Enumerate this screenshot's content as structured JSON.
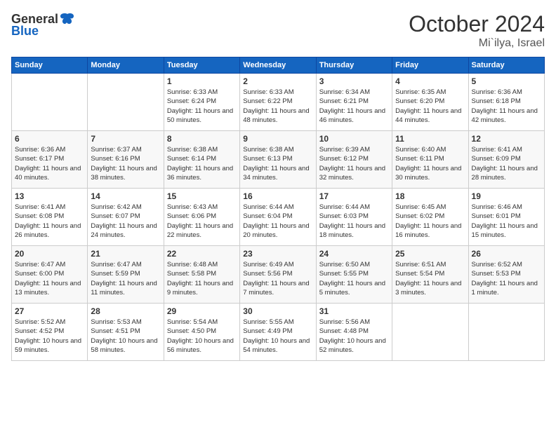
{
  "logo": {
    "general": "General",
    "blue": "Blue"
  },
  "title": "October 2024",
  "location": "Mi`ilya, Israel",
  "days_header": [
    "Sunday",
    "Monday",
    "Tuesday",
    "Wednesday",
    "Thursday",
    "Friday",
    "Saturday"
  ],
  "weeks": [
    [
      {
        "day": "",
        "info": ""
      },
      {
        "day": "",
        "info": ""
      },
      {
        "day": "1",
        "info": "Sunrise: 6:33 AM\nSunset: 6:24 PM\nDaylight: 11 hours and 50 minutes."
      },
      {
        "day": "2",
        "info": "Sunrise: 6:33 AM\nSunset: 6:22 PM\nDaylight: 11 hours and 48 minutes."
      },
      {
        "day": "3",
        "info": "Sunrise: 6:34 AM\nSunset: 6:21 PM\nDaylight: 11 hours and 46 minutes."
      },
      {
        "day": "4",
        "info": "Sunrise: 6:35 AM\nSunset: 6:20 PM\nDaylight: 11 hours and 44 minutes."
      },
      {
        "day": "5",
        "info": "Sunrise: 6:36 AM\nSunset: 6:18 PM\nDaylight: 11 hours and 42 minutes."
      }
    ],
    [
      {
        "day": "6",
        "info": "Sunrise: 6:36 AM\nSunset: 6:17 PM\nDaylight: 11 hours and 40 minutes."
      },
      {
        "day": "7",
        "info": "Sunrise: 6:37 AM\nSunset: 6:16 PM\nDaylight: 11 hours and 38 minutes."
      },
      {
        "day": "8",
        "info": "Sunrise: 6:38 AM\nSunset: 6:14 PM\nDaylight: 11 hours and 36 minutes."
      },
      {
        "day": "9",
        "info": "Sunrise: 6:38 AM\nSunset: 6:13 PM\nDaylight: 11 hours and 34 minutes."
      },
      {
        "day": "10",
        "info": "Sunrise: 6:39 AM\nSunset: 6:12 PM\nDaylight: 11 hours and 32 minutes."
      },
      {
        "day": "11",
        "info": "Sunrise: 6:40 AM\nSunset: 6:11 PM\nDaylight: 11 hours and 30 minutes."
      },
      {
        "day": "12",
        "info": "Sunrise: 6:41 AM\nSunset: 6:09 PM\nDaylight: 11 hours and 28 minutes."
      }
    ],
    [
      {
        "day": "13",
        "info": "Sunrise: 6:41 AM\nSunset: 6:08 PM\nDaylight: 11 hours and 26 minutes."
      },
      {
        "day": "14",
        "info": "Sunrise: 6:42 AM\nSunset: 6:07 PM\nDaylight: 11 hours and 24 minutes."
      },
      {
        "day": "15",
        "info": "Sunrise: 6:43 AM\nSunset: 6:06 PM\nDaylight: 11 hours and 22 minutes."
      },
      {
        "day": "16",
        "info": "Sunrise: 6:44 AM\nSunset: 6:04 PM\nDaylight: 11 hours and 20 minutes."
      },
      {
        "day": "17",
        "info": "Sunrise: 6:44 AM\nSunset: 6:03 PM\nDaylight: 11 hours and 18 minutes."
      },
      {
        "day": "18",
        "info": "Sunrise: 6:45 AM\nSunset: 6:02 PM\nDaylight: 11 hours and 16 minutes."
      },
      {
        "day": "19",
        "info": "Sunrise: 6:46 AM\nSunset: 6:01 PM\nDaylight: 11 hours and 15 minutes."
      }
    ],
    [
      {
        "day": "20",
        "info": "Sunrise: 6:47 AM\nSunset: 6:00 PM\nDaylight: 11 hours and 13 minutes."
      },
      {
        "day": "21",
        "info": "Sunrise: 6:47 AM\nSunset: 5:59 PM\nDaylight: 11 hours and 11 minutes."
      },
      {
        "day": "22",
        "info": "Sunrise: 6:48 AM\nSunset: 5:58 PM\nDaylight: 11 hours and 9 minutes."
      },
      {
        "day": "23",
        "info": "Sunrise: 6:49 AM\nSunset: 5:56 PM\nDaylight: 11 hours and 7 minutes."
      },
      {
        "day": "24",
        "info": "Sunrise: 6:50 AM\nSunset: 5:55 PM\nDaylight: 11 hours and 5 minutes."
      },
      {
        "day": "25",
        "info": "Sunrise: 6:51 AM\nSunset: 5:54 PM\nDaylight: 11 hours and 3 minutes."
      },
      {
        "day": "26",
        "info": "Sunrise: 6:52 AM\nSunset: 5:53 PM\nDaylight: 11 hours and 1 minute."
      }
    ],
    [
      {
        "day": "27",
        "info": "Sunrise: 5:52 AM\nSunset: 4:52 PM\nDaylight: 10 hours and 59 minutes."
      },
      {
        "day": "28",
        "info": "Sunrise: 5:53 AM\nSunset: 4:51 PM\nDaylight: 10 hours and 58 minutes."
      },
      {
        "day": "29",
        "info": "Sunrise: 5:54 AM\nSunset: 4:50 PM\nDaylight: 10 hours and 56 minutes."
      },
      {
        "day": "30",
        "info": "Sunrise: 5:55 AM\nSunset: 4:49 PM\nDaylight: 10 hours and 54 minutes."
      },
      {
        "day": "31",
        "info": "Sunrise: 5:56 AM\nSunset: 4:48 PM\nDaylight: 10 hours and 52 minutes."
      },
      {
        "day": "",
        "info": ""
      },
      {
        "day": "",
        "info": ""
      }
    ]
  ]
}
